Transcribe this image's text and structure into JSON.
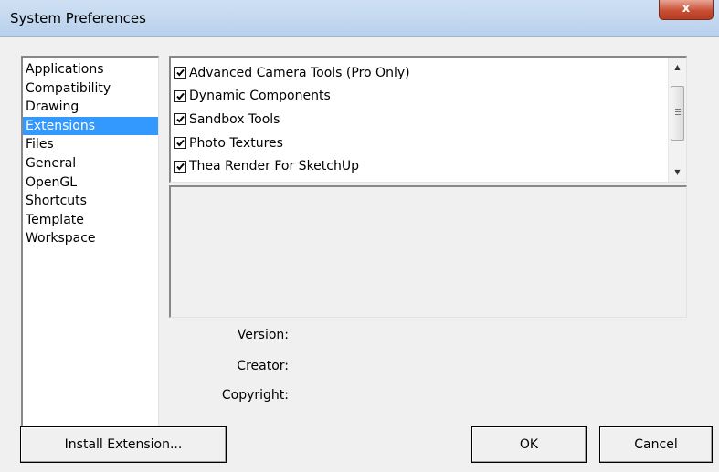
{
  "window": {
    "title": "System Preferences",
    "close_label": "x"
  },
  "categories": [
    {
      "label": "Applications",
      "selected": false
    },
    {
      "label": "Compatibility",
      "selected": false
    },
    {
      "label": "Drawing",
      "selected": false
    },
    {
      "label": "Extensions",
      "selected": true
    },
    {
      "label": "Files",
      "selected": false
    },
    {
      "label": "General",
      "selected": false
    },
    {
      "label": "OpenGL",
      "selected": false
    },
    {
      "label": "Shortcuts",
      "selected": false
    },
    {
      "label": "Template",
      "selected": false
    },
    {
      "label": "Workspace",
      "selected": false
    }
  ],
  "extensions": [
    {
      "label": "Advanced Camera Tools (Pro Only)",
      "checked": true
    },
    {
      "label": "Dynamic Components",
      "checked": true
    },
    {
      "label": "Sandbox Tools",
      "checked": true
    },
    {
      "label": "Photo Textures",
      "checked": true
    },
    {
      "label": "Thea Render For SketchUp",
      "checked": true
    }
  ],
  "info": {
    "version_label": "Version:",
    "creator_label": "Creator:",
    "copyright_label": "Copyright:"
  },
  "buttons": {
    "install": "Install Extension...",
    "ok": "OK",
    "cancel": "Cancel"
  },
  "icons": {
    "close": "close-icon",
    "checkbox": "checkmark-icon",
    "scroll_up": "scroll-up-arrow-icon",
    "scroll_down": "scroll-down-arrow-icon"
  },
  "colors": {
    "selection": "#3399ff",
    "titlebar": "#b9d1ec",
    "close_button": "#c84f34"
  }
}
